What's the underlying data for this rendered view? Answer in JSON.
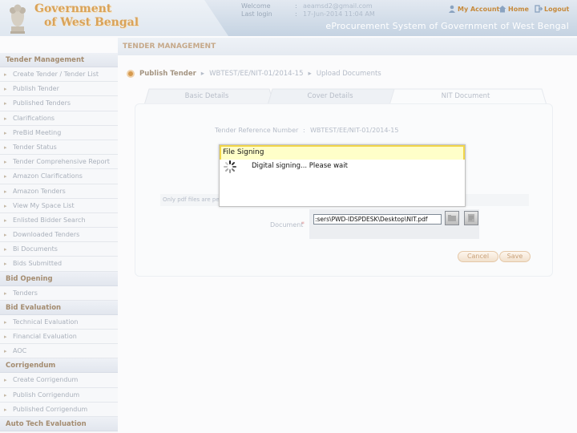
{
  "header": {
    "gov_line1": "Government",
    "gov_line2": "of West Bengal",
    "welcome_label": "Welcome",
    "welcome_sep": ":",
    "welcome_value": "aeamsd2@gmail.com",
    "lastlogin_label": "Last login",
    "lastlogin_sep": ":",
    "lastlogin_value": "17-Jun-2014 11:04 AM",
    "my_account": "My Account",
    "home": "Home",
    "logout": "Logout",
    "app_title": "eProcurement System of Government of West Bengal"
  },
  "main": {
    "title": "TENDER MANAGEMENT",
    "breadcrumb": [
      "Publish Tender",
      "WBTEST/EE/NIT-01/2014-15",
      "Upload Documents"
    ],
    "tabs": [
      "Basic Details",
      "Cover Details",
      "NIT Document"
    ],
    "ref_label": "Tender Reference Number",
    "ref_sep": ":",
    "ref_value": "WBTEST/EE/NIT-01/2014-15",
    "only_pdf_note": "Only pdf files are pe",
    "document_label": "Document",
    "document_required": "*",
    "file_path": ":sers\\PWD-IDSPDESK\\Desktop\\NIT.pdf",
    "cancel": "Cancel",
    "save": "Save"
  },
  "dialog": {
    "title": "File Signing",
    "message": "Digital signing... Please wait"
  },
  "sidebar": {
    "sections": [
      {
        "heading": "Tender Management",
        "items": [
          "Create Tender / Tender List",
          "Publish Tender",
          "Published Tenders",
          "Clarifications",
          "PreBid Meeting",
          "Tender Status",
          "Tender Comprehensive Report",
          "Amazon Clarifications",
          "Amazon Tenders",
          "View My Space List",
          "Enlisted Bidder Search",
          "Downloaded Tenders",
          "Bi Documents",
          "Bids Submitted"
        ]
      },
      {
        "heading": "Bid Opening",
        "items": [
          "Tenders"
        ]
      },
      {
        "heading": "Bid Evaluation",
        "items": [
          "Technical Evaluation",
          "Financial Evaluation",
          "AOC"
        ]
      },
      {
        "heading": "Corrigendum",
        "items": [
          "Create Corrigendum",
          "Publish Corrigendum",
          "Published Corrigendum"
        ]
      },
      {
        "heading": "Auto Tech Evaluation",
        "items": []
      }
    ]
  }
}
